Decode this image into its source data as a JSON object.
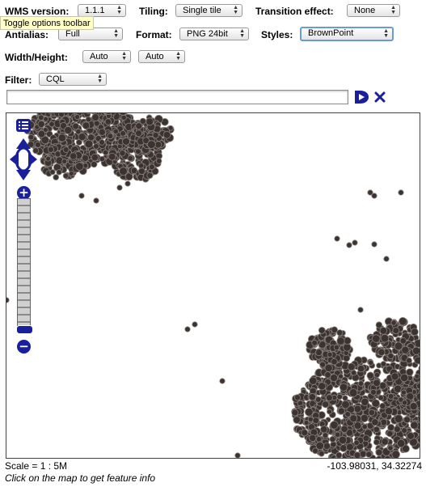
{
  "toolbar": {
    "wms_version_label": "WMS version:",
    "wms_version_value": "1.1.1",
    "tiling_label": "Tiling:",
    "tiling_value": "Single tile",
    "transition_label": "Transition effect:",
    "transition_value": "None",
    "antialias_label": "Antialias:",
    "antialias_value": "Full",
    "format_label": "Format:",
    "format_value": "PNG 24bit",
    "styles_label": "Styles:",
    "styles_value": "BrownPoint",
    "width_height_label": "Width/Height:",
    "width_value": "Auto",
    "height_value": "Auto",
    "filter_label": "Filter:",
    "filter_type_value": "CQL",
    "filter_text": ""
  },
  "tooltip": {
    "text": "Toggle options toolbar"
  },
  "map": {
    "zoom_in_label": "+",
    "zoom_out_label": "−",
    "point_fill": "#3b3330",
    "point_stroke": "#8a807c"
  },
  "status": {
    "scale_text": "Scale = 1 : 5M",
    "coordinates": "-103.98031, 34.32274",
    "hint": "Click on the map to get feature info"
  },
  "colors": {
    "control_blue": "#1a1f9c",
    "tooltip_bg": "#ffffc6"
  }
}
